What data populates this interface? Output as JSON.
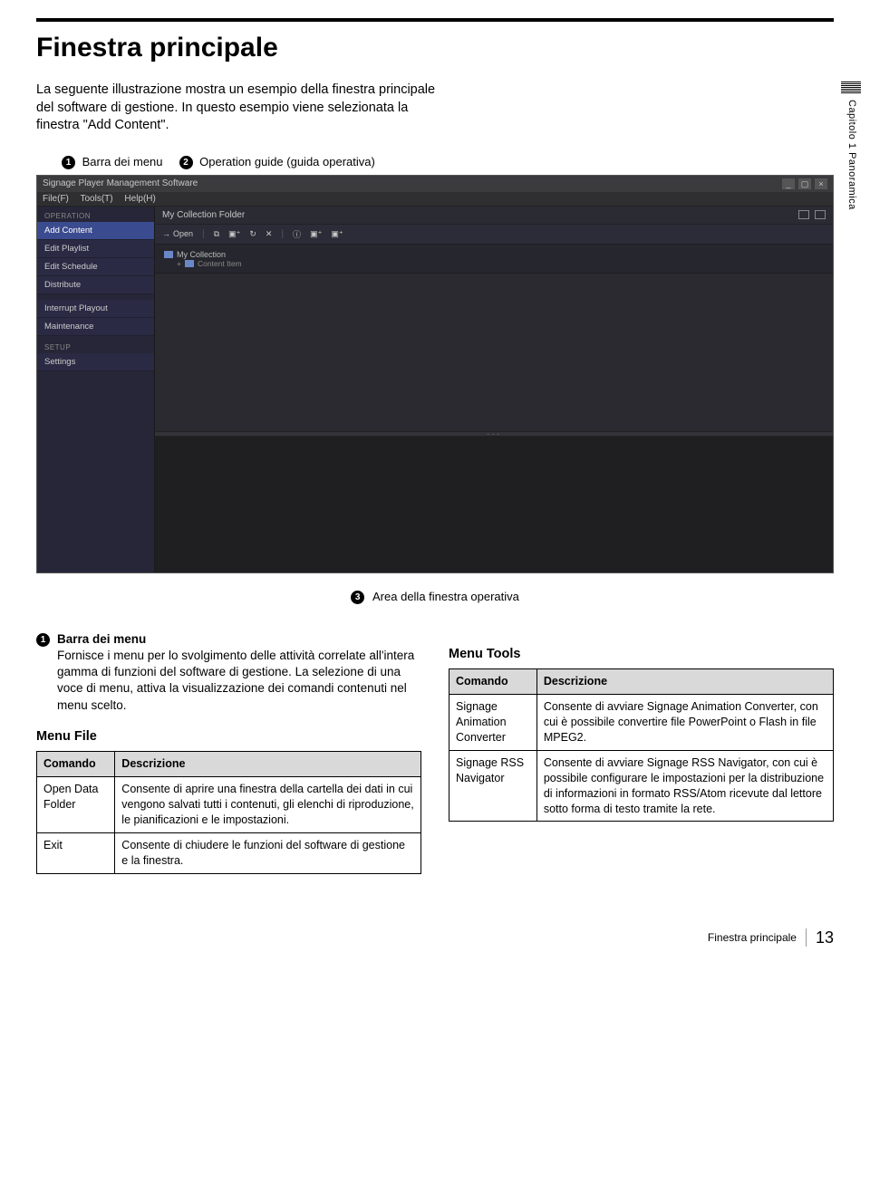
{
  "page": {
    "title": "Finestra principale",
    "intro": "La seguente illustrazione mostra un esempio della finestra principale del software di gestione. In questo esempio viene selezionata la finestra \"Add Content\".",
    "side_label": "Capitolo 1  Panoramica"
  },
  "callouts": {
    "c1": "1",
    "c1_label": "Barra dei menu",
    "c2": "2",
    "c2_label": "Operation guide (guida operativa)",
    "c3": "3",
    "c3_label": "Area della finestra operativa"
  },
  "app": {
    "title": "Signage Player Management Software",
    "menubar": {
      "file": "File(F)",
      "tools": "Tools(T)",
      "help": "Help(H)"
    },
    "sidebar": {
      "header1": "OPERATION",
      "items": [
        "Add Content",
        "Edit Playlist",
        "Edit Schedule",
        "Distribute",
        "Interrupt Playout",
        "Maintenance"
      ],
      "header2": "SETUP",
      "settings": "Settings"
    },
    "main": {
      "header": "My Collection Folder",
      "toolbar_open": "Open",
      "tree_root": "My Collection",
      "tree_child": "Content Item"
    }
  },
  "section1": {
    "num": "1",
    "heading": "Barra dei menu",
    "body": "Fornisce i menu per lo svolgimento delle attività correlate all'intera gamma di funzioni del software di gestione. La selezione di una voce di menu, attiva la visualizzazione dei comandi contenuti nel menu scelto."
  },
  "menu_file": {
    "title": "Menu File",
    "cols": {
      "c1": "Comando",
      "c2": "Descrizione"
    },
    "rows": [
      {
        "cmd": "Open Data Folder",
        "desc": "Consente di aprire una finestra della cartella dei dati in cui vengono salvati tutti i contenuti, gli elenchi di riproduzione, le pianificazioni e le impostazioni."
      },
      {
        "cmd": "Exit",
        "desc": "Consente di chiudere le funzioni del software di gestione e la finestra."
      }
    ]
  },
  "menu_tools": {
    "title": "Menu Tools",
    "cols": {
      "c1": "Comando",
      "c2": "Descrizione"
    },
    "rows": [
      {
        "cmd": "Signage Animation Converter",
        "desc": "Consente di avviare Signage Animation Converter, con cui è possibile convertire file PowerPoint o Flash in file MPEG2."
      },
      {
        "cmd": "Signage RSS Navigator",
        "desc": "Consente di avviare Signage RSS Navigator, con cui è possibile configurare le impostazioni per la distribuzione di informazioni in formato RSS/Atom ricevute dal lettore sotto forma di testo tramite la rete."
      }
    ]
  },
  "footer": {
    "title": "Finestra principale",
    "page": "13"
  }
}
